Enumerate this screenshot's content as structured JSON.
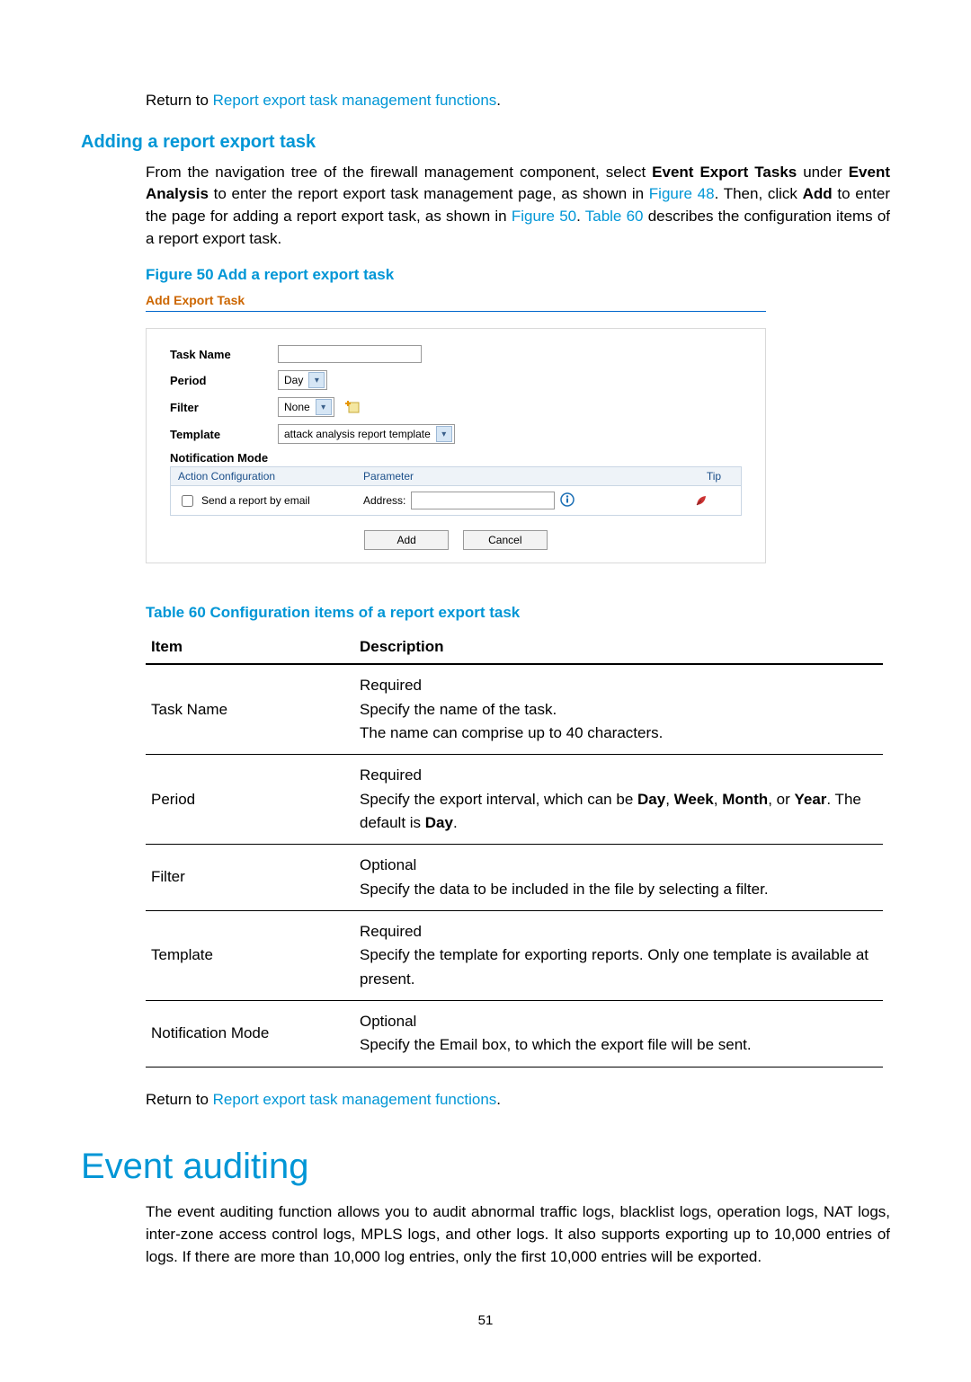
{
  "intro": {
    "return_prefix": "Return to ",
    "return_link": "Report export task management functions",
    "return_suffix": "."
  },
  "section_a": {
    "heading": "Adding a report export task",
    "para_before_fig48": "From the navigation tree of the firewall management component, select ",
    "bold1": "Event Export Tasks",
    "under": " under ",
    "bold2": "Event Analysis",
    "after_bold2": " to enter the report export task management page, as shown in ",
    "fig48_link": "Figure 48",
    "after_fig48": ". Then, click ",
    "bold_add": "Add",
    "after_add": " to enter the page for adding a report export task, as shown in ",
    "fig50_link": "Figure 50",
    "after_fig50": ". ",
    "table60_link": "Table 60",
    "after_table60": " describes the configuration items of a report export task."
  },
  "fig50_caption": "Figure 50 Add a report export task",
  "form": {
    "panel_title": "Add Export Task",
    "labels": {
      "task_name": "Task Name",
      "period": "Period",
      "filter": "Filter",
      "template": "Template",
      "notification": "Notification Mode"
    },
    "period_value": "Day",
    "filter_value": "None",
    "template_value": "attack analysis report template",
    "grid": {
      "col_action": "Action Configuration",
      "col_parameter": "Parameter",
      "col_tip": "Tip",
      "row1_action": "Send a report by email",
      "row1_param_label": "Address:"
    },
    "btn_add": "Add",
    "btn_cancel": "Cancel"
  },
  "table60_caption": "Table 60 Configuration items of a report export task",
  "table60": {
    "head_item": "Item",
    "head_desc": "Description",
    "rows": [
      {
        "item": "Task Name",
        "desc_parts": [
          {
            "t": "Required"
          },
          {
            "t": "Specify the name of the task."
          },
          {
            "t": "The name can comprise up to 40 characters."
          }
        ]
      },
      {
        "item": "Period",
        "desc_html": "Required<br>Specify the export interval, which can be <b>Day</b>, <b>Week</b>, <b>Month</b>, or <b>Year</b>. The default is <b>Day</b>."
      },
      {
        "item": "Filter",
        "desc_parts": [
          {
            "t": "Optional"
          },
          {
            "t": "Specify the data to be included in the file by selecting a filter."
          }
        ]
      },
      {
        "item": "Template",
        "desc_parts": [
          {
            "t": "Required"
          },
          {
            "t": "Specify the template for exporting reports. Only one template is available at present."
          }
        ]
      },
      {
        "item": "Notification Mode",
        "desc_parts": [
          {
            "t": "Optional"
          },
          {
            "t": "Specify the Email box, to which the export file will be sent."
          }
        ]
      }
    ]
  },
  "return2": {
    "prefix": "Return to ",
    "link": "Report export task management functions",
    "suffix": "."
  },
  "chapter": {
    "heading": "Event auditing",
    "para": "The event auditing function allows you to audit abnormal traffic logs, blacklist logs, operation logs, NAT logs, inter-zone access control logs, MPLS logs, and other logs. It also supports exporting up to 10,000 entries of logs. If there are more than 10,000 log entries, only the first 10,000 entries will be exported."
  },
  "pagenum": "51"
}
